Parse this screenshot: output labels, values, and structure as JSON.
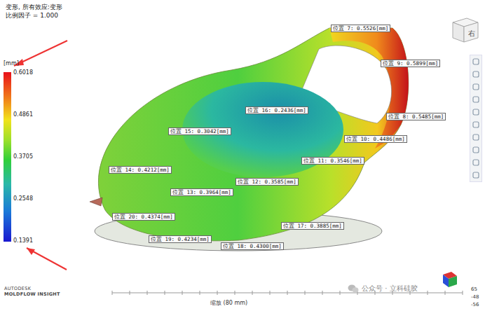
{
  "title": {
    "lines": [
      "变形, 所有效应:变形",
      "比例因子 = 1.000"
    ]
  },
  "legend": {
    "unit": "[mm]",
    "ticks": [
      "0.6018",
      "0.4861",
      "0.3705",
      "0.2548",
      "0.1391"
    ]
  },
  "probes": [
    {
      "label": "位置 7: 0.5526[mm]"
    },
    {
      "label": "位置 9: 0.5899[mm]"
    },
    {
      "label": "位置 8: 0.5485[mm]"
    },
    {
      "label": "位置 16: 0.2436[mm]"
    },
    {
      "label": "位置 15: 0.3042[mm]"
    },
    {
      "label": "位置 10: 0.4486[mm]"
    },
    {
      "label": "位置 11: 0.3546[mm]"
    },
    {
      "label": "位置 14: 0.4212[mm]"
    },
    {
      "label": "位置 12: 0.3585[mm]"
    },
    {
      "label": "位置 13: 0.3964[mm]"
    },
    {
      "label": "位置 20: 0.4374[mm]"
    },
    {
      "label": "位置 17: 0.3885[mm]"
    },
    {
      "label": "位置 19: 0.4234[mm]"
    },
    {
      "label": "位置 18: 0.4300[mm]"
    }
  ],
  "view_cube": {
    "face": "右"
  },
  "scale": {
    "label": "缩放 (80 mm)"
  },
  "brand": {
    "company": "AUTODESK",
    "product": "MOLDFLOW INSIGHT"
  },
  "coordinates": [
    "65",
    "-48",
    "-56"
  ],
  "watermark": "公众号 · 立科硅胶"
}
